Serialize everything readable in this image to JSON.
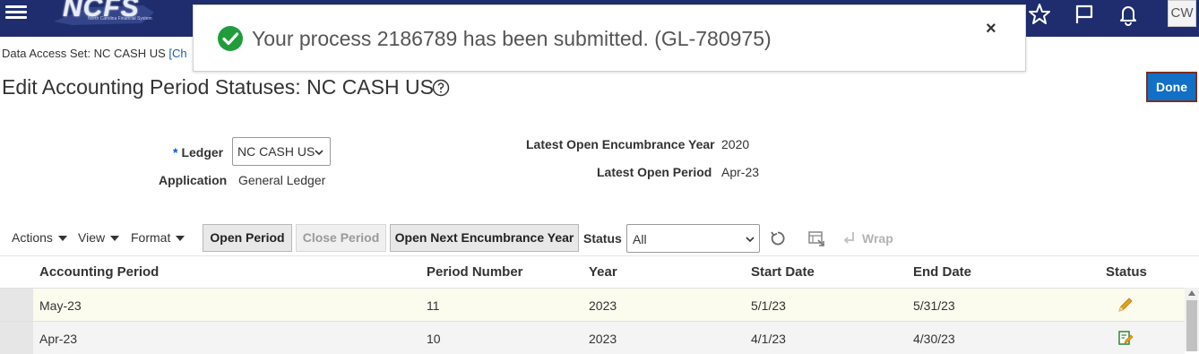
{
  "header": {
    "logo_text": "NCFS",
    "logo_subtext": "North Carolina Financial System",
    "user_initials": "CW"
  },
  "toast": {
    "message": "Your process 2186789 has been submitted. (GL-780975)",
    "close_label": "×"
  },
  "data_access": {
    "label": "Data Access Set: NC CASH US",
    "link_text": "[Ch"
  },
  "page": {
    "title": "Edit Accounting Period Statuses: NC CASH US",
    "done_label": "Done"
  },
  "form": {
    "ledger_required": "*",
    "ledger_label": "Ledger",
    "ledger_value": "NC CASH US",
    "application_label": "Application",
    "application_value": "General Ledger",
    "latest_open_encumbrance_year_label": "Latest Open Encumbrance Year",
    "latest_open_encumbrance_year_value": "2020",
    "latest_open_period_label": "Latest Open Period",
    "latest_open_period_value": "Apr-23"
  },
  "toolbar": {
    "actions_label": "Actions",
    "view_label": "View",
    "format_label": "Format",
    "open_period_label": "Open Period",
    "close_period_label": "Close Period",
    "open_next_encumbrance_year_label": "Open Next Encumbrance Year",
    "status_label": "Status",
    "status_value": "All",
    "wrap_label": "Wrap"
  },
  "table": {
    "columns": [
      "Accounting Period",
      "Period Number",
      "Year",
      "Start Date",
      "End Date",
      "Status"
    ],
    "rows": [
      {
        "period": "May-23",
        "number": "11",
        "year": "2023",
        "start": "5/1/23",
        "end": "5/31/23",
        "status_icon": "pencil-icon"
      },
      {
        "period": "Apr-23",
        "number": "10",
        "year": "2023",
        "start": "4/1/23",
        "end": "4/30/23",
        "status_icon": "edit-document-icon"
      }
    ]
  },
  "colors": {
    "header_bg": "#1f2d6f",
    "success_green": "#1f9d3c",
    "done_button": "#1270c6",
    "done_border": "#7a2e23"
  }
}
